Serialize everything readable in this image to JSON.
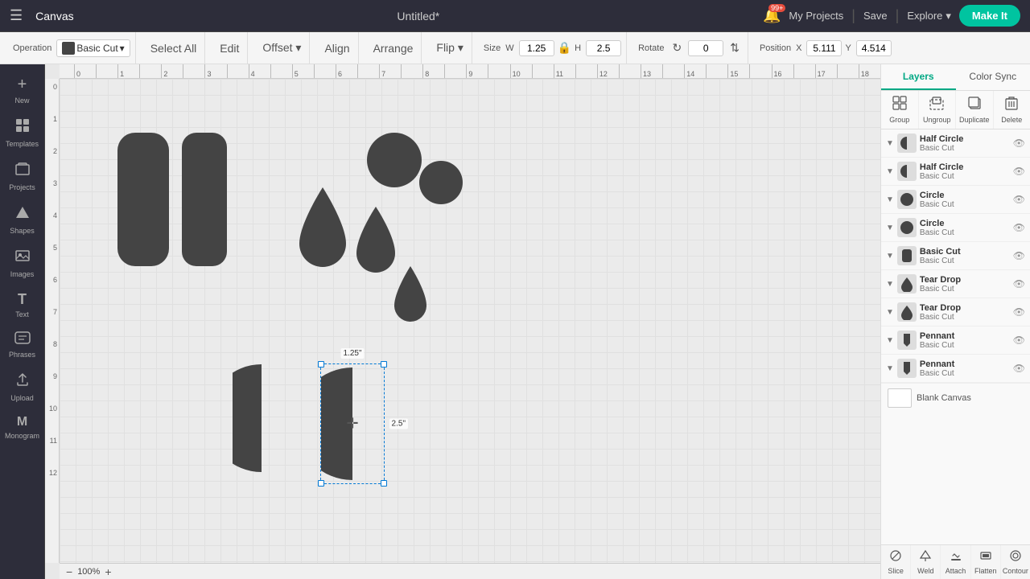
{
  "app": {
    "title": "Canvas",
    "document_title": "Untitled*"
  },
  "topbar": {
    "canvas_label": "Canvas",
    "title": "Untitled*",
    "bell_badge": "99+",
    "my_projects_label": "My Projects",
    "save_label": "Save",
    "explore_label": "Explore",
    "make_it_label": "Make It"
  },
  "toolbar": {
    "operation_label": "Operation",
    "operation_value": "Basic Cut",
    "select_all_label": "Select All",
    "edit_label": "Edit",
    "offset_label": "Offset",
    "align_label": "Align",
    "arrange_label": "Arrange",
    "flip_label": "Flip",
    "size_label": "Size",
    "width_value": "1.25",
    "height_value": "2.5",
    "rotate_label": "Rotate",
    "rotate_value": "0",
    "position_label": "Position",
    "x_value": "5.111",
    "y_value": "4.514"
  },
  "left_sidebar": {
    "items": [
      {
        "id": "new",
        "icon": "+",
        "label": "New"
      },
      {
        "id": "templates",
        "icon": "⊞",
        "label": "Templates"
      },
      {
        "id": "projects",
        "icon": "🗂",
        "label": "Projects"
      },
      {
        "id": "shapes",
        "icon": "◆",
        "label": "Shapes"
      },
      {
        "id": "images",
        "icon": "🖼",
        "label": "Images"
      },
      {
        "id": "text",
        "icon": "T",
        "label": "Text"
      },
      {
        "id": "phrases",
        "icon": "❝",
        "label": "Phrases"
      },
      {
        "id": "upload",
        "icon": "⬆",
        "label": "Upload"
      },
      {
        "id": "monogram",
        "icon": "M",
        "label": "Monogram"
      }
    ]
  },
  "canvas": {
    "zoom": "100%",
    "ruler_marks": [
      "0",
      "",
      "1",
      "",
      "2",
      "",
      "3",
      "",
      "4",
      "",
      "5",
      "",
      "6",
      "",
      "7",
      "",
      "8",
      "",
      "9",
      "",
      "10",
      "",
      "11",
      "",
      "12",
      "",
      "13",
      "",
      "14",
      "",
      "15",
      "",
      "16",
      "",
      "17",
      "",
      "18"
    ],
    "dim_width": "1.25\"",
    "dim_height": "2.5\""
  },
  "panel": {
    "tabs": [
      {
        "id": "layers",
        "label": "Layers",
        "active": true
      },
      {
        "id": "color_sync",
        "label": "Color Sync",
        "active": false
      }
    ],
    "actions": [
      {
        "id": "group",
        "icon": "⊞",
        "label": "Group"
      },
      {
        "id": "ungroup",
        "icon": "⊟",
        "label": "Ungroup"
      },
      {
        "id": "duplicate",
        "icon": "⧉",
        "label": "Duplicate"
      },
      {
        "id": "delete",
        "icon": "🗑",
        "label": "Delete"
      }
    ],
    "layers": [
      {
        "id": "half-circle-1",
        "name": "Half Circle",
        "sub": "Basic Cut",
        "shape": "half-circle",
        "color": "#444"
      },
      {
        "id": "half-circle-2",
        "name": "Half Circle",
        "sub": "Basic Cut",
        "shape": "half-circle",
        "color": "#444"
      },
      {
        "id": "circle-1",
        "name": "Circle",
        "sub": "Basic Cut",
        "shape": "circle",
        "color": "#444"
      },
      {
        "id": "circle-2",
        "name": "Circle",
        "sub": "Basic Cut",
        "shape": "circle",
        "color": "#444"
      },
      {
        "id": "basic-cut-1",
        "name": "Basic Cut",
        "sub": "Basic Cut",
        "shape": "rounded-rect",
        "color": "#444"
      },
      {
        "id": "tear-drop-1",
        "name": "Tear Drop",
        "sub": "Basic Cut",
        "shape": "tear",
        "color": "#444"
      },
      {
        "id": "tear-drop-2",
        "name": "Tear Drop",
        "sub": "Basic Cut",
        "shape": "tear",
        "color": "#444"
      },
      {
        "id": "pennant-1",
        "name": "Pennant",
        "sub": "Basic Cut",
        "shape": "pennant",
        "color": "#444"
      },
      {
        "id": "pennant-2",
        "name": "Pennant",
        "sub": "Basic Cut",
        "shape": "pennant",
        "color": "#444"
      }
    ],
    "blank_canvas": "Blank Canvas",
    "bottom_actions": [
      {
        "id": "slice",
        "icon": "✂",
        "label": "Slice"
      },
      {
        "id": "weld",
        "icon": "⬡",
        "label": "Weld"
      },
      {
        "id": "attach",
        "icon": "📌",
        "label": "Attach"
      },
      {
        "id": "flatten",
        "icon": "▣",
        "label": "Flatten"
      },
      {
        "id": "contour",
        "icon": "◎",
        "label": "Contour"
      }
    ]
  }
}
